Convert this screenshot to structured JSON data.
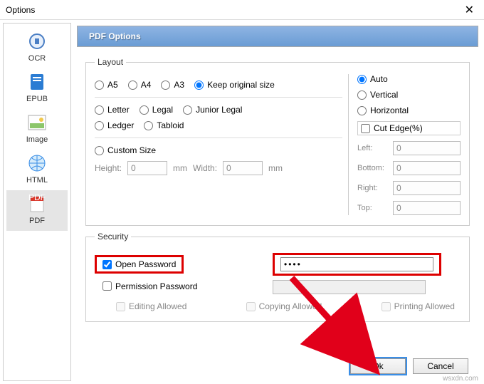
{
  "window": {
    "title": "Options",
    "close": "✕"
  },
  "sidebar": {
    "items": [
      {
        "label": "OCR"
      },
      {
        "label": "EPUB"
      },
      {
        "label": "Image"
      },
      {
        "label": "HTML"
      },
      {
        "label": "PDF"
      }
    ]
  },
  "header": {
    "title": "PDF Options"
  },
  "layout": {
    "legend": "Layout",
    "sizes": {
      "a5": "A5",
      "a4": "A4",
      "a3": "A3",
      "keep": "Keep original size"
    },
    "paper": {
      "letter": "Letter",
      "legal": "Legal",
      "junior": "Junior Legal",
      "ledger": "Ledger",
      "tabloid": "Tabloid"
    },
    "custom": "Custom Size",
    "height_lbl": "Height:",
    "height_val": "0",
    "width_lbl": "Width:",
    "width_val": "0",
    "unit": "mm",
    "orient": {
      "auto": "Auto",
      "vertical": "Vertical",
      "horizontal": "Horizontal"
    },
    "cutedge": {
      "label": "Cut Edge(%)",
      "left_lbl": "Left:",
      "left_val": "0",
      "bottom_lbl": "Bottom:",
      "bottom_val": "0",
      "right_lbl": "Right:",
      "right_val": "0",
      "top_lbl": "Top:",
      "top_val": "0"
    }
  },
  "security": {
    "legend": "Security",
    "open_pw": "Open Password",
    "open_pw_val": "●●●●",
    "perm_pw": "Permission Password",
    "perm_pw_val": "",
    "editing": "Editing Allowed",
    "copying": "Copying Allowed",
    "printing": "Printing Allowed"
  },
  "footer": {
    "ok": "Ok",
    "cancel": "Cancel"
  },
  "watermark": "wsxdn.com",
  "colors": {
    "highlight": "#d00",
    "arrow": "#e1001a",
    "header_grad_a": "#8eb4e3",
    "header_grad_b": "#6a9cd4"
  }
}
